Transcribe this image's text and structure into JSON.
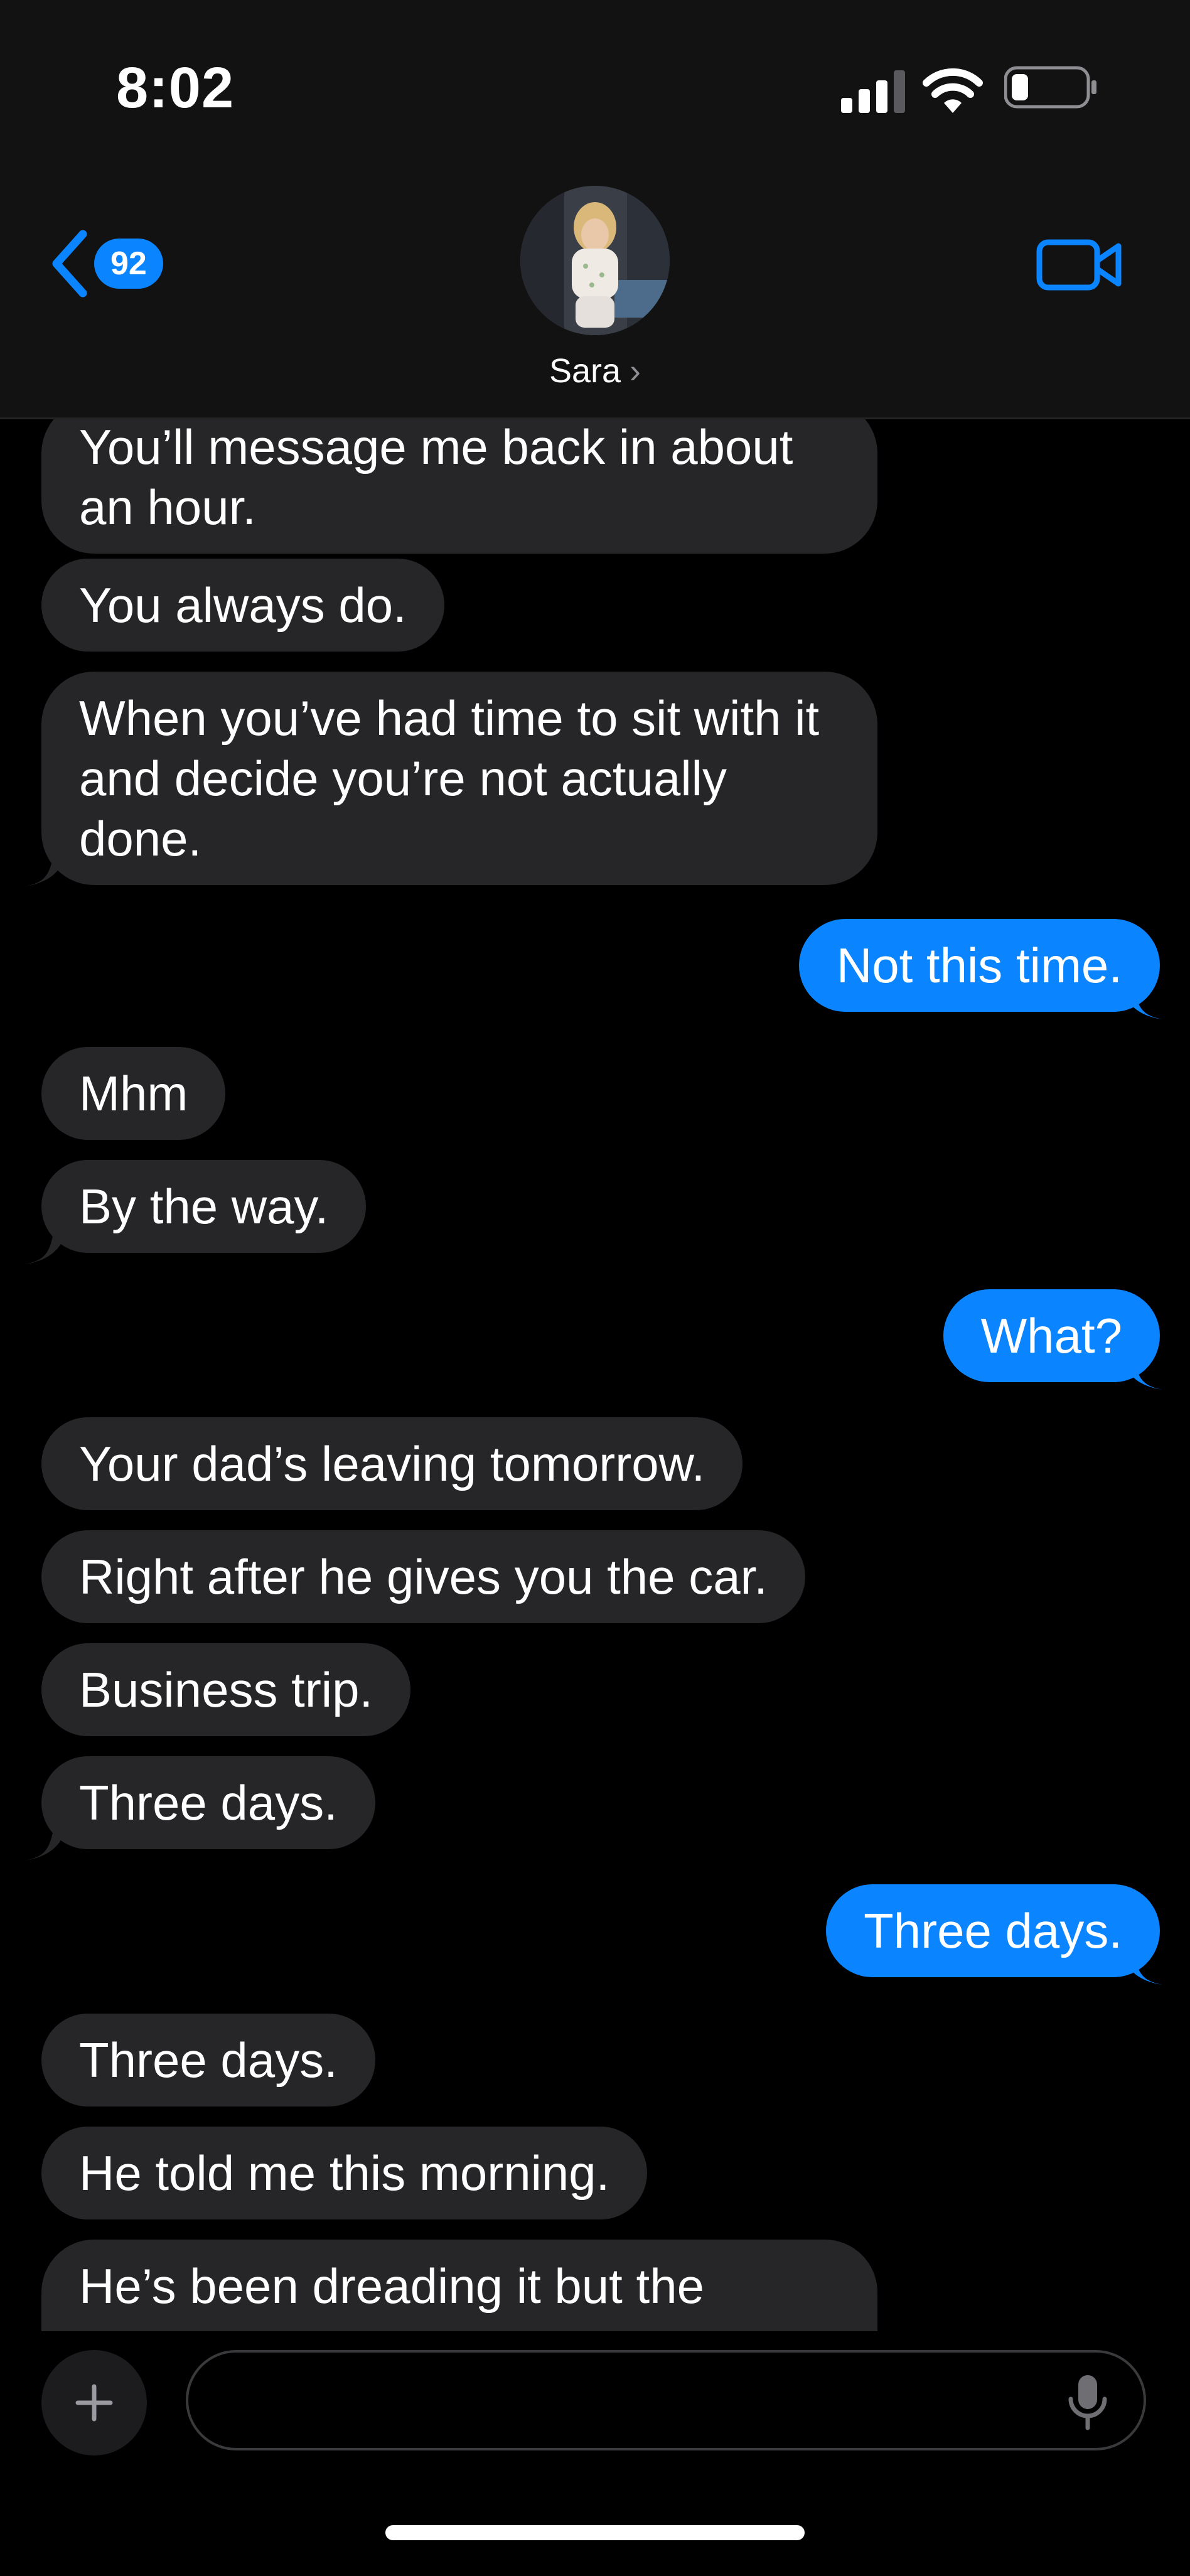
{
  "status": {
    "time": "8:02"
  },
  "header": {
    "back_count": "92",
    "contact_name": "Sara",
    "name_chevron": "›"
  },
  "messages": [
    {
      "side": "in",
      "text": "You’ll message me back in about an hour."
    },
    {
      "side": "in",
      "text": "You always do."
    },
    {
      "side": "in",
      "text": "When you’ve had time to sit with it and decide you’re not actually done."
    },
    {
      "side": "out",
      "text": "Not this time."
    },
    {
      "side": "in",
      "text": "Mhm"
    },
    {
      "side": "in",
      "text": "By the way."
    },
    {
      "side": "out",
      "text": "What?"
    },
    {
      "side": "in",
      "text": "Your dad’s leaving tomorrow."
    },
    {
      "side": "in",
      "text": "Right after he gives you the car."
    },
    {
      "side": "in",
      "text": "Business trip."
    },
    {
      "side": "in",
      "text": "Three days."
    },
    {
      "side": "out",
      "text": "Three days."
    },
    {
      "side": "in",
      "text": "Three days."
    },
    {
      "side": "in",
      "text": "He told me this morning."
    },
    {
      "side": "in",
      "text": "He’s been dreading it but the"
    }
  ],
  "composer": {
    "placeholder": ""
  },
  "icons": {
    "back": "chevron-left-icon",
    "video": "video-camera-icon",
    "plus": "plus-icon",
    "mic": "microphone-icon"
  },
  "colors": {
    "accent": "#0a84ff",
    "incoming_bubble": "#262628",
    "background": "#000000",
    "header": "#121212"
  }
}
